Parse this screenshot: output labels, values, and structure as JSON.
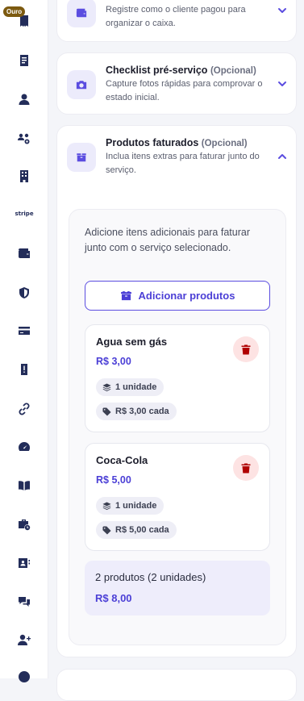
{
  "sidebar": {
    "badge": "Ouro",
    "stripe_label": "stripe",
    "icons": [
      "receipt-icon",
      "document-icon",
      "user-icon",
      "users-gear-icon",
      "building-icon",
      "stripe-logo",
      "wallet-icon",
      "shield-icon",
      "credit-card-icon",
      "alert-badge-icon",
      "link-icon",
      "gauge-icon",
      "book-icon",
      "toolbox-clock-icon",
      "contact-card-icon",
      "chat-icon",
      "user-plus-icon",
      "info-icon"
    ]
  },
  "sections": {
    "payment": {
      "description": "Registre como o cliente pagou para organizar o caixa.",
      "icon": "wallet-icon"
    },
    "checklist": {
      "title": "Checklist pré-serviço",
      "optional": "(Opcional)",
      "description": "Capture fotos rápidas para comprovar o estado inicial.",
      "icon": "camera-icon"
    },
    "products": {
      "title": "Produtos faturados",
      "optional": "(Opcional)",
      "description": "Inclua itens extras para faturar junto do serviço.",
      "icon": "box-icon",
      "panel_description": "Adicione itens adicionais para faturar junto com o serviço selecionado.",
      "add_button": "Adicionar produtos",
      "items": [
        {
          "name": "Agua sem gás",
          "price": "R$ 3,00",
          "quantity": "1 unidade",
          "unit_price": "R$ 3,00 cada"
        },
        {
          "name": "Coca-Cola",
          "price": "R$ 5,00",
          "quantity": "1 unidade",
          "unit_price": "R$ 5,00 cada"
        }
      ],
      "summary_count": "2 produtos (2 unidades)",
      "summary_total": "R$ 8,00"
    }
  },
  "colors": {
    "accent": "#5b4de0",
    "accent_text": "#4b3fd6",
    "delete_bg": "#fde3e3",
    "delete_icon": "#b00000",
    "badge_bg": "#7c5a10"
  }
}
